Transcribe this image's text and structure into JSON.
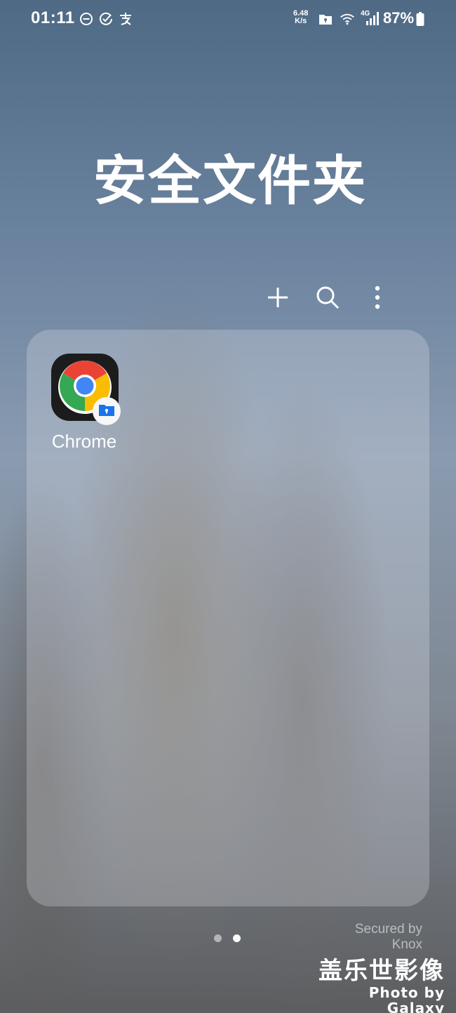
{
  "status_bar": {
    "time": "01:11",
    "net_speed_value": "6.48",
    "net_speed_unit": "K/s",
    "signal_label": "4G",
    "battery": "87%"
  },
  "page": {
    "title": "安全文件夹"
  },
  "toolbar": {
    "add_icon": "plus-icon",
    "search_icon": "search-icon",
    "more_icon": "more-vertical-icon"
  },
  "apps": [
    {
      "label": "Chrome",
      "icon": "chrome-icon",
      "badge": "secure-folder-badge-icon"
    }
  ],
  "pagination": {
    "total": 2,
    "current": 2
  },
  "footer": {
    "knox_line1": "Secured by",
    "knox_line2": "Knox"
  },
  "watermark": {
    "cn": "盖乐世影像",
    "en": "Photo by Galaxy"
  },
  "colors": {
    "chrome_red": "#ea4335",
    "chrome_yellow": "#fbbc04",
    "chrome_green": "#34a853",
    "chrome_blue": "#4285f4",
    "badge_blue": "#1a73e8"
  }
}
